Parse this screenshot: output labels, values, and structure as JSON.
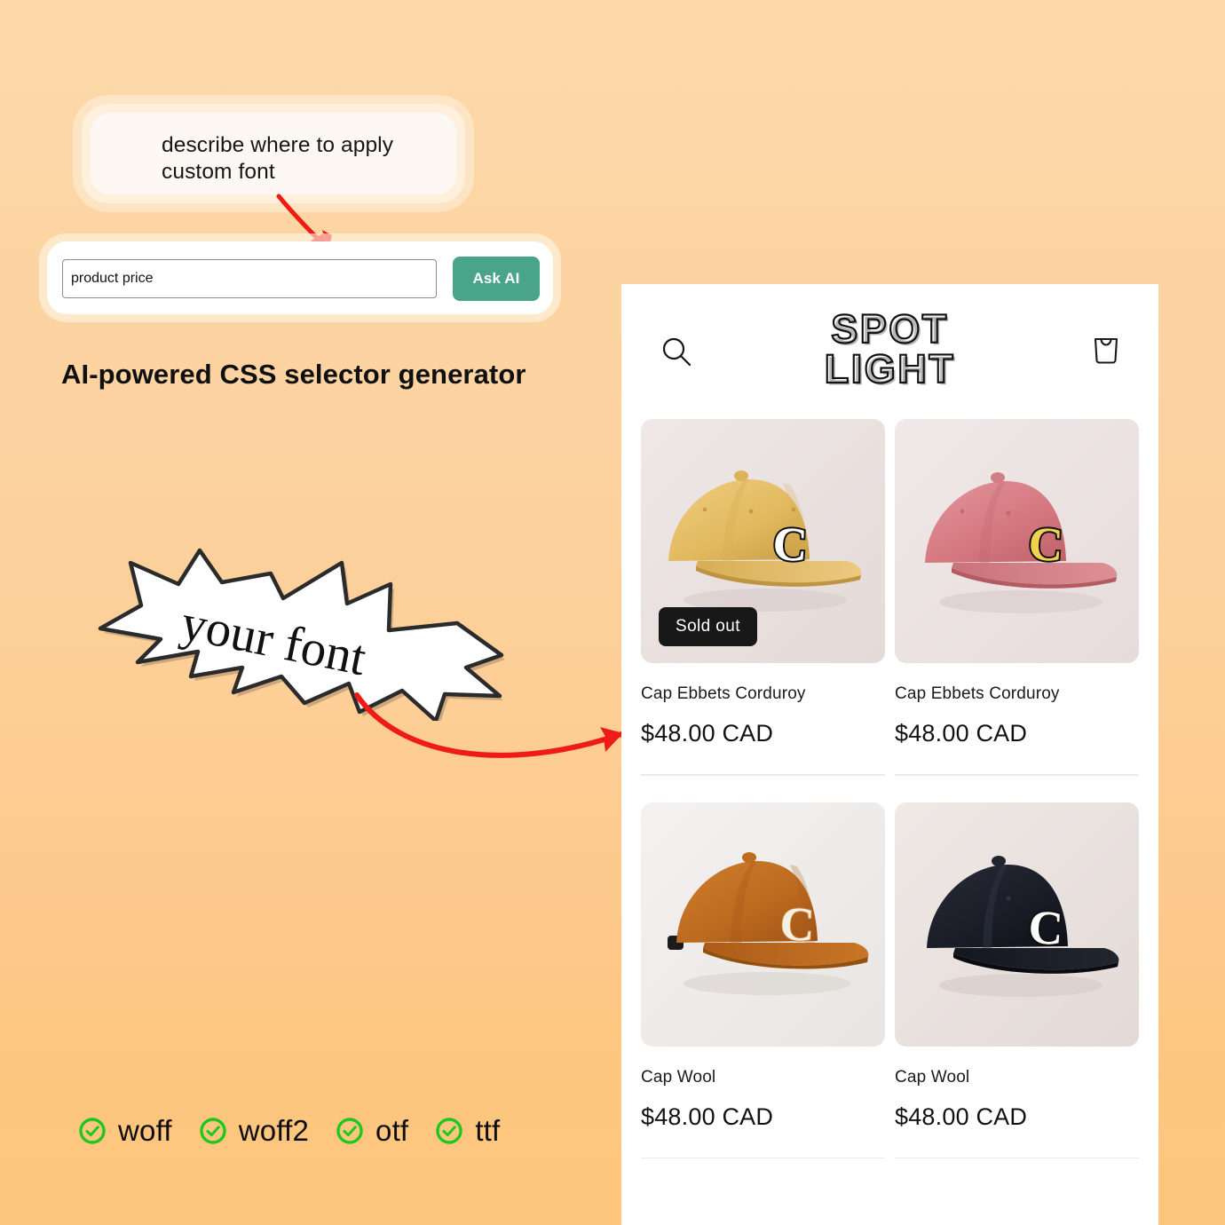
{
  "tooltip": {
    "text": "describe where to apply custom font"
  },
  "search": {
    "value": "product price",
    "placeholder": "product price",
    "button_label": "Ask AI",
    "button_color": "#4AA487"
  },
  "caption": {
    "text": "AI-powered CSS selector generator"
  },
  "starburst": {
    "label": "your font"
  },
  "formats": {
    "items": [
      {
        "label": "woff",
        "icon": "check-circle-icon"
      },
      {
        "label": "woff2",
        "icon": "check-circle-icon"
      },
      {
        "label": "otf",
        "icon": "check-circle-icon"
      },
      {
        "label": "ttf",
        "icon": "check-circle-icon"
      }
    ],
    "check_color": "#1FC81F"
  },
  "store": {
    "brand_line1": "SPOT",
    "brand_line2": "LIGHT",
    "search_icon": "search-icon",
    "cart_icon": "shopping-bag-icon",
    "products": [
      {
        "title": "Cap Ebbets Corduroy",
        "price": "$48.00 CAD",
        "badge": "Sold out",
        "hat_color": "#E0B860",
        "hat_shadow": "#C99F45",
        "bg_color": "#EBE2E0",
        "patch": "light"
      },
      {
        "title": "Cap Ebbets Corduroy",
        "price": "$48.00 CAD",
        "badge": "",
        "hat_color": "#D97C82",
        "hat_shadow": "#C2666D",
        "bg_color": "#EDE6E5",
        "patch": "yellow"
      },
      {
        "title": "Cap Wool",
        "price": "$48.00 CAD",
        "badge": "",
        "hat_color": "#C06B21",
        "hat_shadow": "#A8581A",
        "bg_color": "#EFEDEB",
        "patch": "cream"
      },
      {
        "title": "Cap Wool",
        "price": "$48.00 CAD",
        "badge": "",
        "hat_color": "#181A22",
        "hat_shadow": "#0D0F16",
        "bg_color": "#EAE3E0",
        "patch": "white"
      }
    ]
  },
  "accents": {
    "arrow_color": "#EE1C14",
    "background_top": "#FDD9AC",
    "background_bottom": "#FEC67C"
  }
}
